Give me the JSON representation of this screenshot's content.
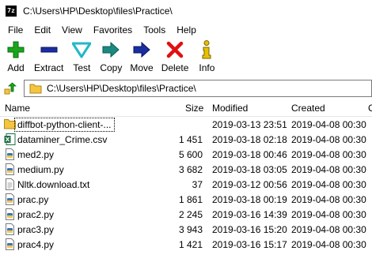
{
  "window": {
    "app_icon_text": "7z",
    "title": "C:\\Users\\HP\\Desktop\\files\\Practice\\"
  },
  "menu": [
    "File",
    "Edit",
    "View",
    "Favorites",
    "Tools",
    "Help"
  ],
  "toolbar": {
    "add": "Add",
    "extract": "Extract",
    "test": "Test",
    "copy": "Copy",
    "move": "Move",
    "delete": "Delete",
    "info": "Info"
  },
  "colors": {
    "add": "#1aa51a",
    "extract": "#1a2ea0",
    "test": "#22b8c8",
    "copy": "#1a8a80",
    "move": "#1a2ea0",
    "delete": "#e01010",
    "info": "#e8c000",
    "folder": "#f5c542"
  },
  "address": {
    "path": "C:\\Users\\HP\\Desktop\\files\\Practice\\"
  },
  "columns": {
    "name": "Name",
    "size": "Size",
    "modified": "Modified",
    "created": "Created",
    "extra": "C"
  },
  "files": [
    {
      "name": "diffbot-python-client-...",
      "size": "",
      "modified": "2019-03-13 23:51",
      "created": "2019-04-08 00:30",
      "icon": "folder-icon"
    },
    {
      "name": "dataminer_Crime.csv",
      "size": "1 451",
      "modified": "2019-03-18 02:18",
      "created": "2019-04-08 00:30",
      "icon": "excel-icon"
    },
    {
      "name": "med2.py",
      "size": "5 600",
      "modified": "2019-03-18 00:46",
      "created": "2019-04-08 00:30",
      "icon": "python-file-icon"
    },
    {
      "name": "medium.py",
      "size": "3 682",
      "modified": "2019-03-18 03:05",
      "created": "2019-04-08 00:30",
      "icon": "python-file-icon"
    },
    {
      "name": "Nltk.download.txt",
      "size": "37",
      "modified": "2019-03-12 00:56",
      "created": "2019-04-08 00:30",
      "icon": "text-file-icon"
    },
    {
      "name": "prac.py",
      "size": "1 861",
      "modified": "2019-03-18 00:19",
      "created": "2019-04-08 00:30",
      "icon": "python-file-icon"
    },
    {
      "name": "prac2.py",
      "size": "2 245",
      "modified": "2019-03-16 14:39",
      "created": "2019-04-08 00:30",
      "icon": "python-file-icon"
    },
    {
      "name": "prac3.py",
      "size": "3 943",
      "modified": "2019-03-16 15:20",
      "created": "2019-04-08 00:30",
      "icon": "python-file-icon"
    },
    {
      "name": "prac4.py",
      "size": "1 421",
      "modified": "2019-03-16 15:17",
      "created": "2019-04-08 00:30",
      "icon": "python-file-icon"
    }
  ]
}
